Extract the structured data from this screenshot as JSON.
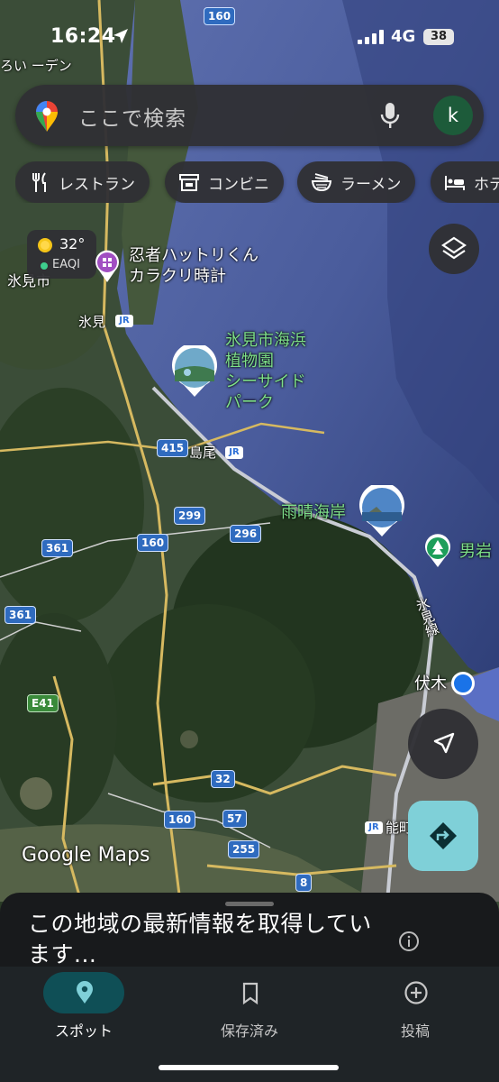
{
  "status_bar": {
    "time": "16:24",
    "network": "4G",
    "battery": "38"
  },
  "search": {
    "placeholder": "ここで検索",
    "avatar_letter": "k"
  },
  "chips": [
    {
      "label": "レストラン",
      "icon": "restaurant-icon"
    },
    {
      "label": "コンビニ",
      "icon": "convenience-store-icon"
    },
    {
      "label": "ラーメン",
      "icon": "ramen-icon"
    },
    {
      "label": "ホテ",
      "icon": "hotel-icon"
    }
  ],
  "weather": {
    "temp": "32°",
    "aqi": "EAQI"
  },
  "map_labels": {
    "poi_ninja": "忍者ハットリくん\nカラクリ時計",
    "poi_garden": "氷見市海浜\n植物園\nシーサイド\nパーク",
    "poi_amaharashi": "雨晴海岸",
    "poi_oiwa": "男岩",
    "city_himi": "氷見市",
    "station_himi": "氷見",
    "station_shimao": "島尾",
    "station_fushiki": "伏木",
    "station_noto": "能町",
    "rail_line": "氷見線",
    "partial_top_left": "ろい\nーデン",
    "google_maps": "Google Maps"
  },
  "route_shields": [
    "160",
    "415",
    "299",
    "296",
    "160",
    "361",
    "361",
    "E41",
    "32",
    "57",
    "160",
    "255",
    "8"
  ],
  "sheet": {
    "message": "この地域の最新情報を取得しています..."
  },
  "tabs": [
    {
      "label": "スポット",
      "icon": "location-pin-icon",
      "active": true
    },
    {
      "label": "保存済み",
      "icon": "bookmark-icon",
      "active": false
    },
    {
      "label": "投稿",
      "icon": "add-circle-icon",
      "active": false
    }
  ],
  "colors": {
    "accent": "#7fd0d8",
    "active_tab": "#0f4f56",
    "poi_green": "#7ee08a",
    "my_location": "#1a73e8"
  }
}
